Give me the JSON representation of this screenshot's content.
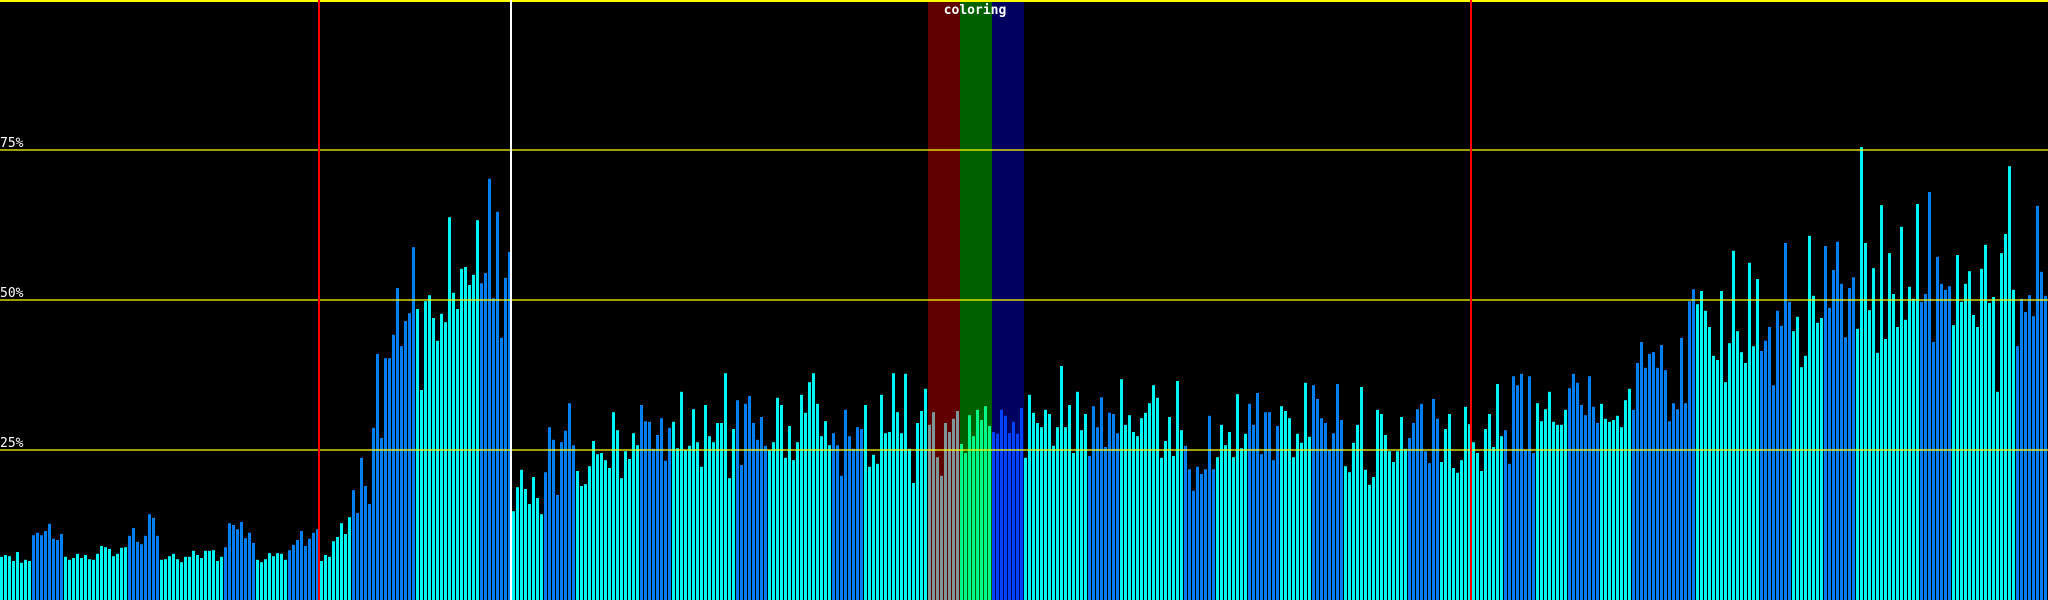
{
  "chart_data": {
    "type": "bar",
    "title": "coloring",
    "ylim": [
      0,
      100
    ],
    "y_unit": "%",
    "gridlines": [
      {
        "value": 25,
        "label": "25%"
      },
      {
        "value": 50,
        "label": "50%"
      },
      {
        "value": 75,
        "label": "75%"
      },
      {
        "value": 100,
        "label": ""
      }
    ],
    "colors": {
      "background": "#000000",
      "grid": "#ffff00",
      "label": "#ffffff",
      "bar_a": "#00f4f0",
      "bar_b": "#0080f0",
      "marker_red": "#ff0000",
      "marker_white": "#ffffff"
    },
    "group_size": 8,
    "group_colors": "abaabaabababbaababaabaabaabaababaabaabababaabaabababbaababaabaab",
    "markers": [
      {
        "index": 80,
        "color": "#ff0000"
      },
      {
        "index": 128,
        "color": "#ffffff"
      },
      {
        "index": 368,
        "color": "#ff0000"
      }
    ],
    "bands": [
      {
        "start": 232,
        "end": 240,
        "bg": "#600000",
        "bar": "#7f9696"
      },
      {
        "start": 240,
        "end": 248,
        "bg": "#006000",
        "bar": "#00f888"
      },
      {
        "start": 248,
        "end": 256,
        "bg": "#000060",
        "bar": "#0044ff"
      }
    ],
    "values": [
      7.2,
      7.5,
      7.3,
      6.5,
      8,
      6.2,
      6.7,
      6.5,
      10.8,
      11.2,
      10.8,
      11.5,
      12.7,
      10.2,
      10,
      11,
      7.2,
      6.7,
      7,
      7.7,
      7,
      7.5,
      6.8,
      6.7,
      7.7,
      9,
      8.8,
      8.5,
      7.3,
      7.7,
      8.7,
      8.8,
      10.7,
      12,
      9.7,
      9.3,
      10.7,
      14.3,
      13.7,
      10.7,
      6.7,
      6.8,
      7.3,
      7.7,
      6.8,
      6.3,
      7.2,
      7.2,
      8.2,
      7.5,
      7,
      8.2,
      8.2,
      8.3,
      6.5,
      7.2,
      8.8,
      12.8,
      12.5,
      11.8,
      13,
      10.3,
      11.2,
      9.5,
      6.7,
      6.3,
      6.8,
      7.8,
      7.3,
      7.8,
      7.7,
      6.7,
      8.3,
      9.2,
      10,
      11.5,
      9,
      10.2,
      11.2,
      11.8,
      6.5,
      7.5,
      7.2,
      9.8,
      10.5,
      12.8,
      11,
      13.8,
      18.3,
      14.5,
      23.7,
      19,
      16,
      28.7,
      41,
      27,
      40.3,
      40.3,
      44.2,
      52,
      42.3,
      46.5,
      47.8,
      58.8,
      48.5,
      35,
      49.8,
      50.8,
      47,
      43.2,
      47.7,
      46.3,
      63.8,
      51.2,
      48.5,
      55.2,
      55.5,
      52.5,
      54.2,
      63.3,
      52.8,
      54.5,
      70.2,
      50.3,
      64.7,
      43.7,
      53.7,
      58,
      14.8,
      18.8,
      21.7,
      18.5,
      16,
      20.5,
      17,
      14.3,
      21.3,
      28.8,
      26.7,
      17.5,
      26.3,
      28.2,
      32.8,
      25.8,
      21.5,
      19,
      19.3,
      22.3,
      26.5,
      24.3,
      24.5,
      23.3,
      22,
      31.3,
      28.3,
      20.3,
      24.8,
      23.5,
      27.8,
      25.8,
      32.5,
      29.8,
      29.7,
      25.2,
      27.5,
      30.3,
      23.2,
      28.7,
      29.7,
      25.3,
      34.7,
      25,
      25.7,
      31.8,
      26.3,
      22.2,
      32.5,
      27.3,
      26.3,
      29.5,
      29.5,
      37.8,
      20.3,
      28.5,
      33.3,
      22.5,
      32.7,
      34,
      29.5,
      26.7,
      30.5,
      25.7,
      25,
      26.3,
      33.7,
      32.5,
      23.7,
      29,
      23.3,
      26.3,
      34.2,
      31.2,
      36.3,
      37.8,
      32.7,
      27.3,
      29.8,
      25.8,
      27.8,
      25.8,
      20.7,
      31.7,
      27.3,
      25.2,
      28.8,
      28.5,
      32.5,
      22.2,
      24.2,
      22.7,
      34.2,
      27.8,
      28,
      37.8,
      31.3,
      27.8,
      37.7,
      25.2,
      19.5,
      29.5,
      31.5,
      35.2,
      29.2,
      31.3,
      23.8,
      20.7,
      29.5,
      28,
      30.2,
      31.5,
      26,
      24.5,
      30.8,
      27.3,
      31.7,
      30,
      32.3,
      29,
      28,
      27.7,
      31.7,
      30.7,
      27.8,
      29.7,
      27.7,
      32,
      23.7,
      34.2,
      31.2,
      29.5,
      28.8,
      31.7,
      31,
      25.7,
      28.8,
      39,
      28.8,
      32.5,
      24.5,
      34.7,
      28.3,
      31,
      24,
      32.3,
      28.8,
      33.8,
      25.5,
      31.2,
      31,
      27.8,
      36.8,
      29.2,
      30.8,
      28,
      27.3,
      30.3,
      31.2,
      32.8,
      35.8,
      33.7,
      23.7,
      26.5,
      30.5,
      24,
      36.5,
      28.3,
      25.7,
      21.8,
      18.2,
      22.2,
      21,
      21.8,
      30.7,
      21.8,
      23.8,
      29.2,
      25.8,
      28,
      23.8,
      34.3,
      25.3,
      27.7,
      32.7,
      29.2,
      34.5,
      24.3,
      31.3,
      31.3,
      23.3,
      29,
      32.3,
      31.5,
      30.3,
      23.8,
      27.7,
      26.2,
      36.2,
      27.2,
      35.8,
      33.5,
      30.3,
      29.5,
      25,
      27.8,
      36,
      30,
      22.3,
      21.3,
      26.2,
      29.2,
      35.5,
      21.7,
      19.2,
      20.5,
      31.7,
      31,
      27.5,
      24.8,
      23,
      24.8,
      30.5,
      25.2,
      27,
      29.5,
      31.8,
      32.7,
      24.8,
      22.8,
      33.5,
      30.2,
      23,
      28.5,
      31,
      22,
      21.2,
      23.3,
      32.2,
      29.3,
      26.3,
      24.5,
      21.5,
      28.5,
      31,
      25.5,
      36,
      27.3,
      28.3,
      22.7,
      37.3,
      35.8,
      37.7,
      25,
      37.3,
      24.5,
      32.8,
      29.8,
      31.8,
      34.7,
      29.7,
      29.2,
      29.2,
      31.7,
      35.3,
      37.7,
      36.2,
      32.5,
      30.8,
      37.3,
      32.2,
      29.5,
      32.7,
      30.2,
      29.7,
      30,
      30.7,
      28.8,
      33.3,
      35.2,
      31.7,
      39.5,
      43,
      38.7,
      41,
      41.3,
      38.7,
      42.5,
      38.3,
      29.8,
      32.8,
      31.8,
      43.7,
      32.8,
      49.8,
      51.8,
      49.3,
      51.5,
      48.2,
      45.5,
      40.7,
      40,
      51.5,
      36.3,
      42.8,
      58.2,
      44.8,
      41.3,
      39.5,
      56.2,
      42.3,
      53.5,
      41.5,
      43.2,
      45.5,
      35.8,
      48.2,
      45.7,
      59.5,
      49.7,
      44.8,
      47.2,
      38.8,
      40.7,
      60.7,
      50.7,
      46.2,
      47,
      59,
      48.7,
      55,
      59.7,
      52.7,
      43.8,
      52,
      53.8,
      45.2,
      75.5,
      59.5,
      48.3,
      55.3,
      41.2,
      65.8,
      43.5,
      57.8,
      51,
      45.5,
      62.2,
      46.7,
      52.2,
      50.2,
      66,
      49.7,
      51,
      68,
      43,
      57.2,
      52.7,
      51.7,
      52.3,
      45.8,
      57.5,
      49.7,
      52.7,
      54.8,
      47.5,
      45.5,
      55.2,
      59.2,
      49.5,
      50.5,
      34.7,
      57.8,
      61,
      72.3,
      51.7,
      42.3,
      50.2,
      48,
      50.8,
      47.3,
      65.7,
      54.7,
      50.7
    ]
  }
}
